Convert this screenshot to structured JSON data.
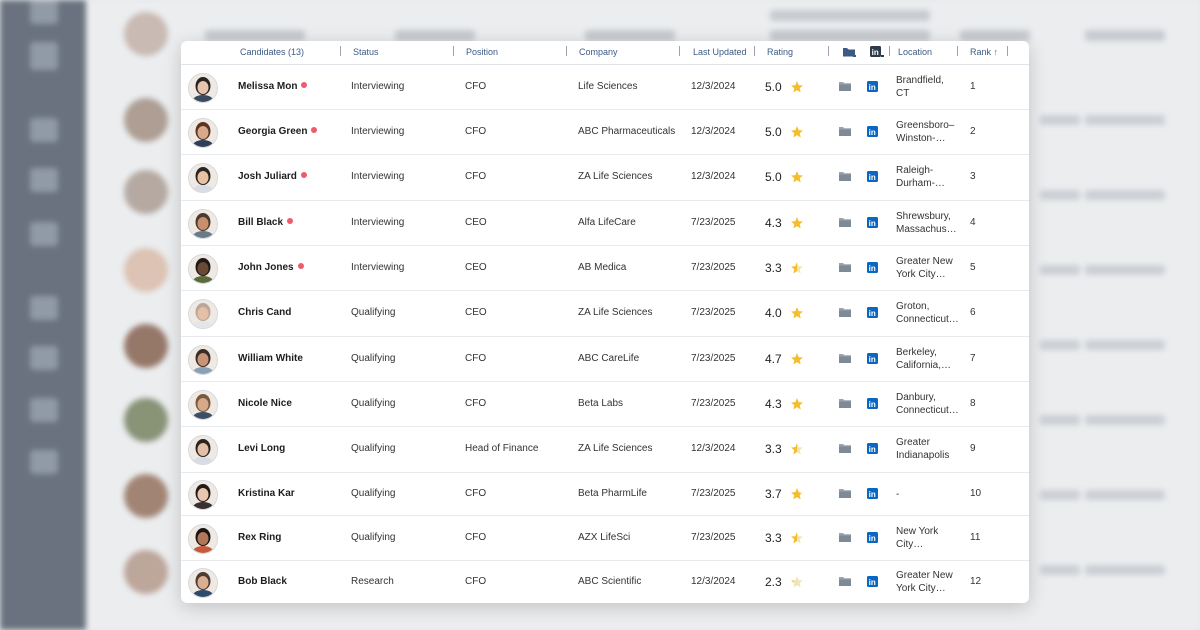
{
  "table": {
    "columns": {
      "candidates": "Candidates (13)",
      "status": "Status",
      "position": "Position",
      "company": "Company",
      "last_updated": "Last Updated",
      "rating": "Rating",
      "location": "Location",
      "rank": "Rank"
    },
    "sort": {
      "column": "rank",
      "direction": "ascending",
      "icon": "arrow-up-icon"
    },
    "accent_color": "#3c5a86",
    "star_color": "#f5bd2a",
    "dot_color": "#ef5b6e",
    "linkedin_color": "#0a66c2",
    "rows": [
      {
        "name": "Melissa Mon",
        "dot": true,
        "status": "Interviewing",
        "position": "CFO",
        "company": "Life Sciences",
        "updated": "12/3/2024",
        "rating": "5.0",
        "stars": 1.0,
        "loc1": "Brandfield,",
        "loc2": "CT",
        "rank": "1"
      },
      {
        "name": "Georgia Green",
        "dot": true,
        "status": "Interviewing",
        "position": "CFO",
        "company": "ABC Pharmaceuticals",
        "updated": "12/3/2024",
        "rating": "5.0",
        "stars": 1.0,
        "loc1": "Greensboro–",
        "loc2": "Winston-…",
        "rank": "2"
      },
      {
        "name": "Josh Juliard",
        "dot": true,
        "status": "Interviewing",
        "position": "CFO",
        "company": "ZA Life Sciences",
        "updated": "12/3/2024",
        "rating": "5.0",
        "stars": 1.0,
        "loc1": "Raleigh-",
        "loc2": "Durham-…",
        "rank": "3"
      },
      {
        "name": "Bill Black",
        "dot": true,
        "status": "Interviewing",
        "position": "CEO",
        "company": "Alfa LifeCare",
        "updated": "7/23/2025",
        "rating": "4.3",
        "stars": 1.0,
        "loc1": "Shrewsbury,",
        "loc2": "Massachus…",
        "rank": "4"
      },
      {
        "name": "John Jones",
        "dot": true,
        "status": "Interviewing",
        "position": "CEO",
        "company": "AB Medica",
        "updated": "7/23/2025",
        "rating": "3.3",
        "stars": 0.5,
        "loc1": "Greater New",
        "loc2": "York City…",
        "rank": "5"
      },
      {
        "name": "Chris Cand",
        "dot": false,
        "status": "Qualifying",
        "position": "CEO",
        "company": "ZA Life Sciences",
        "updated": "7/23/2025",
        "rating": "4.0",
        "stars": 1.0,
        "loc1": "Groton,",
        "loc2": "Connecticut…",
        "rank": "6"
      },
      {
        "name": "William White",
        "dot": false,
        "status": "Qualifying",
        "position": "CFO",
        "company": "ABC CareLife",
        "updated": "7/23/2025",
        "rating": "4.7",
        "stars": 1.0,
        "loc1": "Berkeley,",
        "loc2": "California,…",
        "rank": "7"
      },
      {
        "name": "Nicole Nice",
        "dot": false,
        "status": "Qualifying",
        "position": "CFO",
        "company": "Beta Labs",
        "updated": "7/23/2025",
        "rating": "4.3",
        "stars": 1.0,
        "loc1": "Danbury,",
        "loc2": "Connecticut…",
        "rank": "8"
      },
      {
        "name": "Levi Long",
        "dot": false,
        "status": "Qualifying",
        "position": "Head of Finance",
        "company": "ZA Life Sciences",
        "updated": "12/3/2024",
        "rating": "3.3",
        "stars": 0.5,
        "loc1": "Greater",
        "loc2": "Indianapolis",
        "rank": "9"
      },
      {
        "name": "Kristina Kar",
        "dot": false,
        "status": "Qualifying",
        "position": "CFO",
        "company": "Beta PharmLife",
        "updated": "7/23/2025",
        "rating": "3.7",
        "stars": 0.75,
        "loc1": "-",
        "loc2": "",
        "rank": "10"
      },
      {
        "name": "Rex Ring",
        "dot": false,
        "status": "Qualifying",
        "position": "CFO",
        "company": "AZX LifeSci",
        "updated": "7/23/2025",
        "rating": "3.3",
        "stars": 0.5,
        "loc1": "New York",
        "loc2": "City…",
        "rank": "11"
      },
      {
        "name": "Bob Black",
        "dot": false,
        "status": "Research",
        "position": "CFO",
        "company": "ABC Scientific",
        "updated": "12/3/2024",
        "rating": "2.3",
        "stars": 0.25,
        "loc1": "Greater New",
        "loc2": "York City…",
        "rank": "12"
      }
    ]
  }
}
